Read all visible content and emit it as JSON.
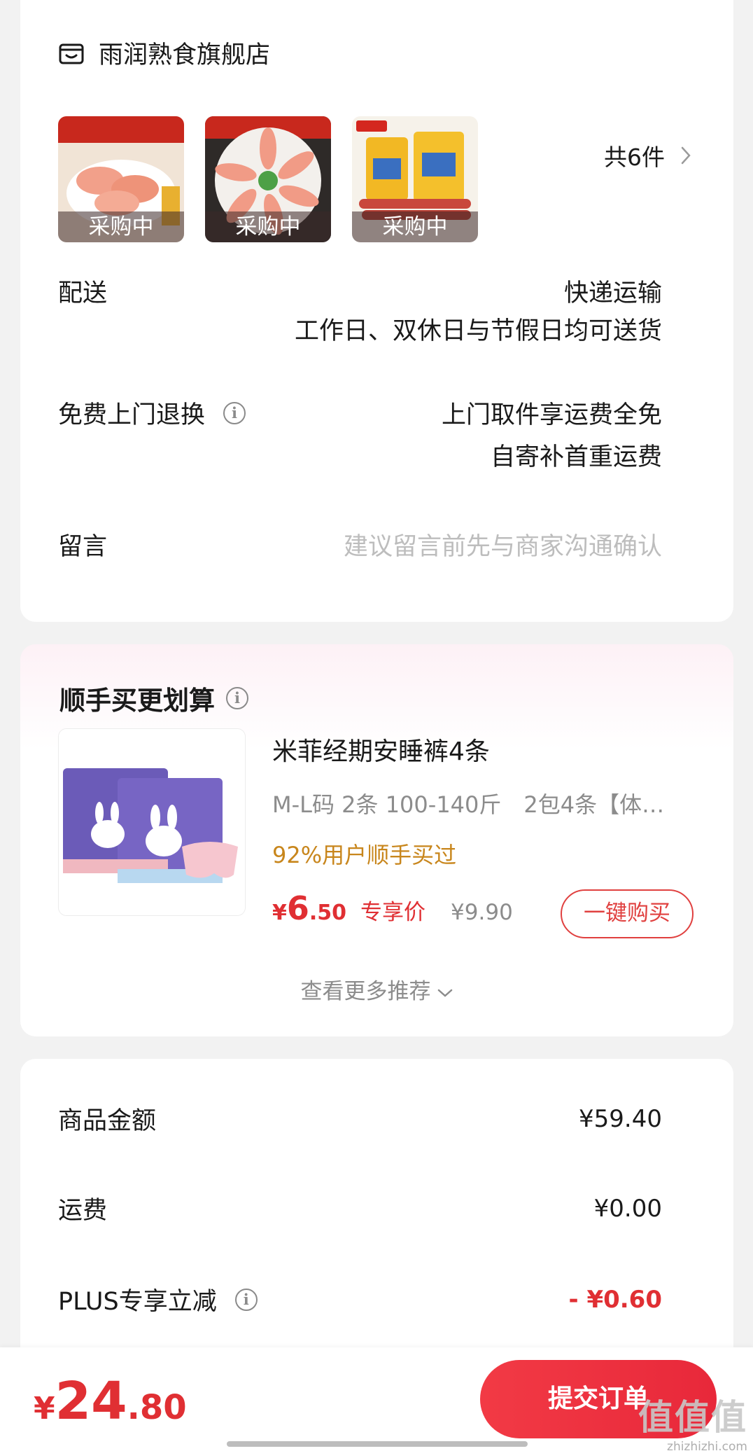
{
  "store": {
    "name": "雨润熟食旗舰店",
    "items": [
      {
        "badge": "采购中",
        "image": "sausage-slices-bowl"
      },
      {
        "badge": "采购中",
        "image": "sausage-slices-plate"
      },
      {
        "badge": "采购中",
        "image": "sausage-packages"
      }
    ],
    "count_label": "共6件"
  },
  "delivery": {
    "label": "配送",
    "method": "快递运输",
    "schedule": "工作日、双休日与节假日均可送货"
  },
  "returns": {
    "label": "免费上门退换",
    "line1": "上门取件享运费全免",
    "line2": "自寄补首重运费"
  },
  "message": {
    "label": "留言",
    "placeholder": "建议留言前先与商家沟通确认"
  },
  "recommend": {
    "title": "顺手买更划算",
    "product": {
      "name": "米菲经期安睡裤4条",
      "spec": "M-L码 2条 100-140斤　2包4条【体…",
      "bought": "92%用户顺手买过",
      "price_yen": "¥",
      "price_int": "6",
      "price_dec": ".50",
      "price_tag": "专享价",
      "original_price": "¥9.90",
      "buy_label": "一键购买"
    },
    "more_label": "查看更多推荐"
  },
  "summary": {
    "rows": [
      {
        "label": "商品金额",
        "value": "¥59.40"
      },
      {
        "label": "运费",
        "value": "¥0.00"
      },
      {
        "label": "PLUS专享立减",
        "value": "- ¥0.60"
      }
    ]
  },
  "bottom": {
    "total_yen": "¥",
    "total_int": "24",
    "total_dec": ".80",
    "submit_label": "提交订单"
  },
  "watermark": {
    "logo": "值值值",
    "url": "zhizhizhi.com"
  },
  "colors": {
    "accent": "#e02f33",
    "bought": "#c8861c",
    "muted": "#8c8c8c"
  }
}
